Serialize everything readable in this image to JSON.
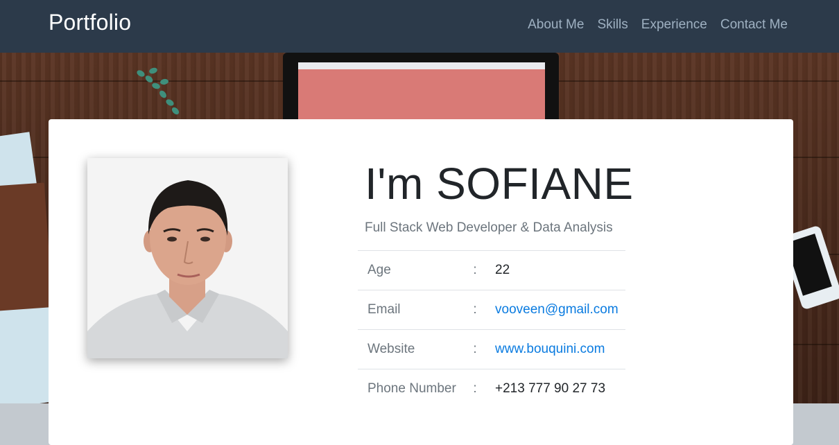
{
  "navbar": {
    "brand": "Portfolio",
    "links": [
      "About Me",
      "Skills",
      "Experience",
      "Contact Me"
    ]
  },
  "profile": {
    "name": "I'm SOFIANE",
    "subtitle": "Full Stack Web Developer & Data Analysis",
    "details": [
      {
        "key": "Age",
        "sep": ":",
        "value": "22",
        "link": false
      },
      {
        "key": "Email",
        "sep": ":",
        "value": "vooveen@gmail.com",
        "link": true
      },
      {
        "key": "Website",
        "sep": ":",
        "value": "www.bouquini.com",
        "link": true
      },
      {
        "key": "Phone Number",
        "sep": ":",
        "value": "+213 777 90 27 73",
        "link": false
      }
    ]
  },
  "colors": {
    "navbar_bg": "#2c3a4a",
    "nav_link": "#9fb1c2",
    "link": "#0a7be0",
    "monitor_screen": "#d97a76"
  }
}
